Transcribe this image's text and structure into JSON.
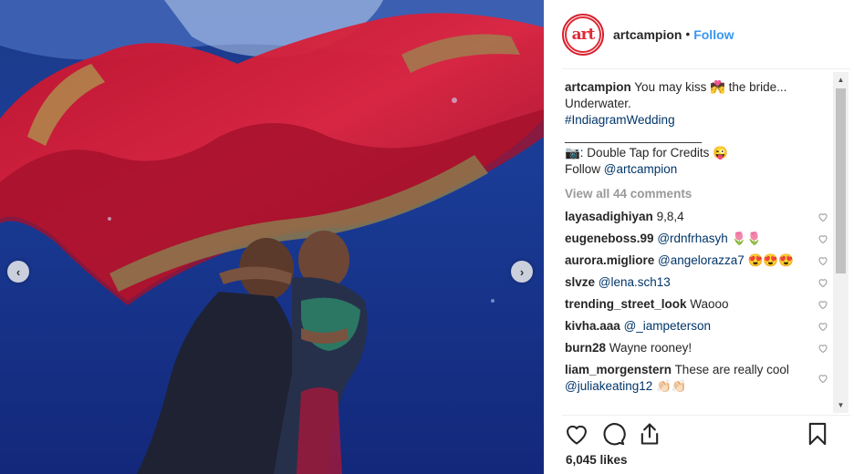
{
  "header": {
    "username": "artcampion",
    "separator": "•",
    "follow_label": "Follow",
    "avatar_text": "art"
  },
  "caption": {
    "username": "artcampion",
    "line1": "You may kiss 💏 the bride...",
    "line2": "Underwater.",
    "hashtag": "#IndiagramWedding",
    "rule": "____________________",
    "credits": "📷: Double Tap for Credits 😜",
    "follow_prefix": "Follow",
    "follow_handle": "@artcampion"
  },
  "view_all": "View all 44 comments",
  "comments": [
    {
      "user": "layasadighiyan",
      "text": "9,8,4",
      "mention": ""
    },
    {
      "user": "eugeneboss.99",
      "text": "🌷🌷",
      "mention": "@rdnfrhasyh"
    },
    {
      "user": "aurora.migliore",
      "text": "😍😍😍",
      "mention": "@angelorazza7"
    },
    {
      "user": "slvze",
      "text": "",
      "mention": "@lena.sch13"
    },
    {
      "user": "trending_street_look",
      "text": "Waooo",
      "mention": ""
    },
    {
      "user": "kivha.aaa",
      "text": "",
      "mention": "@_iampeterson"
    },
    {
      "user": "burn28",
      "text": "Wayne rooney!",
      "mention": ""
    },
    {
      "user": "liam_morgenstern",
      "text": "These are really cool",
      "mention": "@juliakeating12",
      "suffix": "👏🏻👏🏻"
    }
  ],
  "likes": "6,045 likes",
  "icons": {
    "like": "heart-icon",
    "comment": "comment-icon",
    "share": "share-icon",
    "save": "bookmark-icon",
    "prev": "chevron-left-icon",
    "next": "chevron-right-icon"
  },
  "colors": {
    "link": "#003569",
    "follow": "#3897f0",
    "brand_red": "#e02a36"
  }
}
